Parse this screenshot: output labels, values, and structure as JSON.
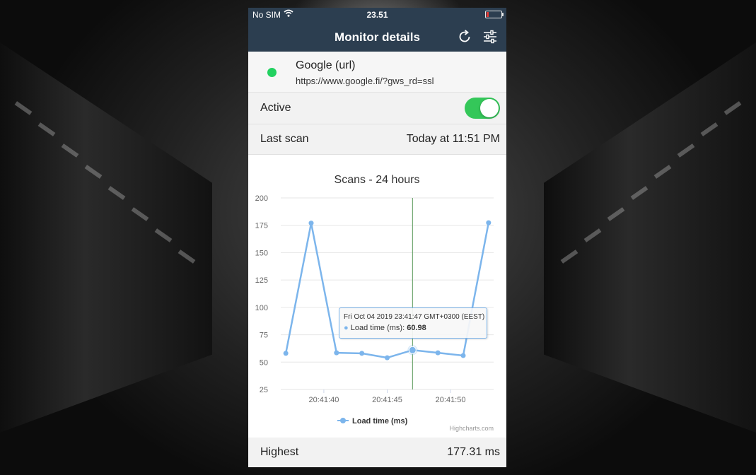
{
  "status_bar": {
    "carrier": "No SIM",
    "time": "23.51"
  },
  "nav": {
    "title": "Monitor details",
    "refresh_icon": "refresh-icon",
    "settings_icon": "sliders-icon"
  },
  "monitor": {
    "name": "Google (url)",
    "url": "https://www.google.fi/?gws_rd=ssl",
    "status_color": "#22d160"
  },
  "active": {
    "label": "Active",
    "enabled": true
  },
  "last_scan": {
    "label": "Last scan",
    "value": "Today at 11:51 PM"
  },
  "highest": {
    "label": "Highest",
    "value": "177.31 ms"
  },
  "chart_data": {
    "type": "line",
    "title": "Scans - 24 hours",
    "xlabel": "",
    "ylabel": "",
    "x_ticks": [
      "20:41:40",
      "20:41:45",
      "20:41:50"
    ],
    "y_ticks": [
      "25",
      "50",
      "75",
      "100",
      "125",
      "150",
      "175",
      "200"
    ],
    "ylim": [
      25,
      200
    ],
    "series": [
      {
        "name": "Load time (ms)",
        "color": "#7cb5ec",
        "values": [
          58,
          177,
          58.5,
          58,
          54,
          60.98,
          58.5,
          56,
          177.31
        ]
      }
    ],
    "x_seconds": [
      37,
      39,
      41,
      43,
      45,
      47,
      49,
      51,
      53
    ],
    "grid": true,
    "legend": "bottom-center",
    "credits": "Highcharts.com",
    "tooltip": {
      "header": "Fri Oct 04 2019 23:41:47 GMT+0300 (EEST)",
      "series_label": "Load time (ms):",
      "value": "60.98",
      "point_index": 5
    }
  }
}
